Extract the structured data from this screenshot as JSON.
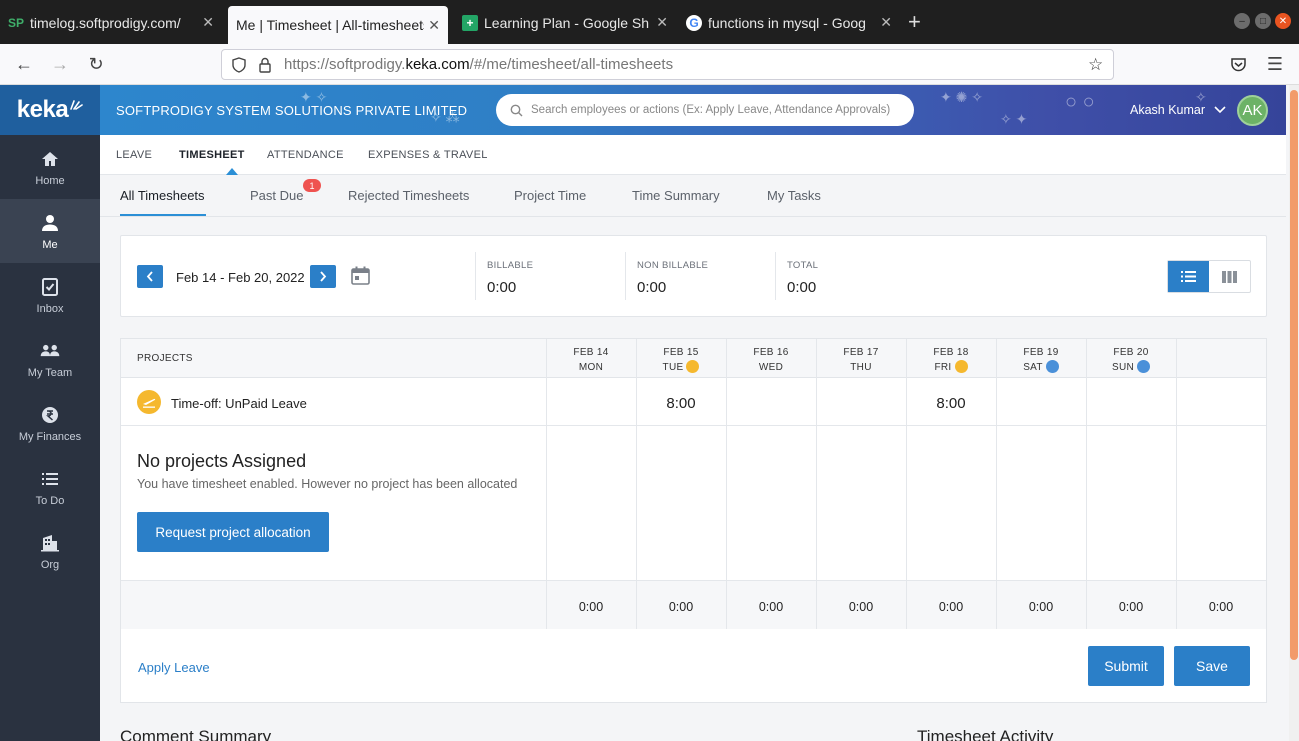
{
  "browser": {
    "tabs": [
      {
        "title": "timelog.softprodigy.com/",
        "favicon": "SP"
      },
      {
        "title": "Me | Timesheet | All-timesheets",
        "favicon": ""
      },
      {
        "title": "Learning Plan - Google Sh",
        "favicon": "+"
      },
      {
        "title": "functions in mysql - Goog",
        "favicon": "G"
      }
    ],
    "url_prefix": "https://softprodigy.",
    "url_domain": "keka.com",
    "url_path": "/#/me/timesheet/all-timesheets"
  },
  "app": {
    "logo": "keka",
    "company": "SOFTPRODIGY SYSTEM SOLUTIONS PRIVATE LIMITED",
    "search_placeholder": "Search employees or actions (Ex: Apply Leave, Attendance Approvals)",
    "user_name": "Akash Kumar",
    "user_initials": "AK"
  },
  "sidebar": {
    "items": [
      {
        "label": "Home",
        "icon": "home-icon"
      },
      {
        "label": "Me",
        "icon": "person-icon"
      },
      {
        "label": "Inbox",
        "icon": "inbox-icon"
      },
      {
        "label": "My Team",
        "icon": "team-icon"
      },
      {
        "label": "My Finances",
        "icon": "rupee-icon"
      },
      {
        "label": "To Do",
        "icon": "list-icon"
      },
      {
        "label": "Org",
        "icon": "building-icon"
      }
    ]
  },
  "topnav": [
    "LEAVE",
    "TIMESHEET",
    "ATTENDANCE",
    "EXPENSES & TRAVEL"
  ],
  "subtabs": [
    "All Timesheets",
    "Past Due",
    "Rejected Timesheets",
    "Project Time",
    "Time Summary",
    "My Tasks"
  ],
  "past_due_count": "1",
  "summary": {
    "date_range": "Feb 14 - Feb 20, 2022",
    "billable_label": "BILLABLE",
    "billable_value": "0:00",
    "non_billable_label": "NON BILLABLE",
    "non_billable_value": "0:00",
    "total_label": "TOTAL",
    "total_value": "0:00"
  },
  "grid": {
    "projects_header": "PROJECTS",
    "days": [
      {
        "date": "FEB 14",
        "day": "MON",
        "marker": ""
      },
      {
        "date": "FEB 15",
        "day": "TUE",
        "marker": "leave"
      },
      {
        "date": "FEB 16",
        "day": "WED",
        "marker": ""
      },
      {
        "date": "FEB 17",
        "day": "THU",
        "marker": ""
      },
      {
        "date": "FEB 18",
        "day": "FRI",
        "marker": "leave"
      },
      {
        "date": "FEB 19",
        "day": "SAT",
        "marker": "weekend"
      },
      {
        "date": "FEB 20",
        "day": "SUN",
        "marker": "weekend"
      }
    ],
    "leave_row": {
      "name": "Time-off: UnPaid Leave",
      "hours": [
        "",
        "8:00",
        "",
        "",
        "8:00",
        "",
        ""
      ]
    },
    "no_projects_title": "No projects Assigned",
    "no_projects_text": "You have timesheet enabled. However no project has been allocated",
    "request_button": "Request project allocation",
    "totals": [
      "0:00",
      "0:00",
      "0:00",
      "0:00",
      "0:00",
      "0:00",
      "0:00",
      "0:00"
    ]
  },
  "actions": {
    "apply_leave": "Apply Leave",
    "submit": "Submit",
    "save": "Save"
  },
  "sections": {
    "comment_summary": "Comment Summary",
    "timesheet_activity": "Timesheet Activity"
  },
  "colors": {
    "primary": "#2b7fc8",
    "sidebar": "#2a3240",
    "leave": "#f5b82e",
    "weekend": "#4a90d9",
    "badge": "#ef5350"
  }
}
